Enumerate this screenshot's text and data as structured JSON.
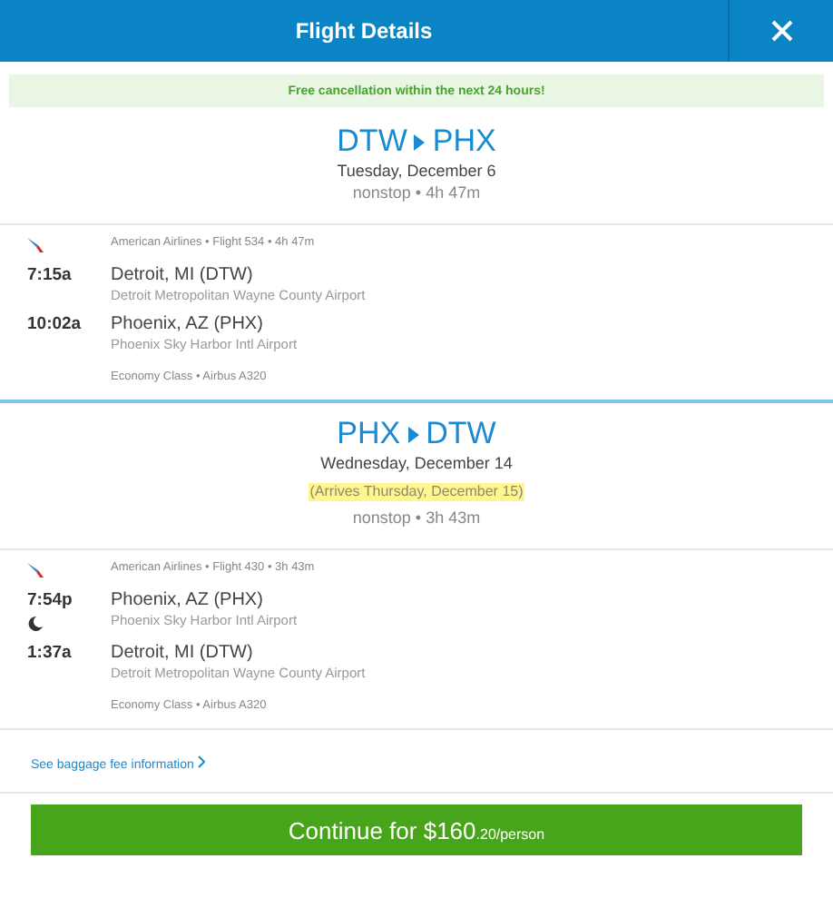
{
  "header": {
    "title": "Flight Details"
  },
  "notice": "Free cancellation within the next 24 hours!",
  "legs": [
    {
      "origin": "DTW",
      "destination": "PHX",
      "date": "Tuesday, December 6",
      "summary": "nonstop • 4h 47m",
      "segment": {
        "info": "American Airlines • Flight 534 • 4h 47m",
        "stops": [
          {
            "time": "7:15a",
            "city": "Detroit, MI (DTW)",
            "airport": "Detroit Metropolitan Wayne County Airport",
            "overnight": false
          },
          {
            "time": "10:02a",
            "city": "Phoenix, AZ (PHX)",
            "airport": "Phoenix Sky Harbor Intl Airport",
            "overnight": false
          }
        ],
        "cabin": "Economy Class • Airbus A320"
      }
    },
    {
      "origin": "PHX",
      "destination": "DTW",
      "date": "Wednesday, December 14",
      "arrival_note": "(Arrives Thursday, December 15)",
      "summary": "nonstop • 3h 43m",
      "segment": {
        "info": "American Airlines • Flight 430 • 3h 43m",
        "stops": [
          {
            "time": "7:54p",
            "city": "Phoenix, AZ (PHX)",
            "airport": "Phoenix Sky Harbor Intl Airport",
            "overnight": true
          },
          {
            "time": "1:37a",
            "city": "Detroit, MI (DTW)",
            "airport": "Detroit Metropolitan Wayne County Airport",
            "overnight": false
          }
        ],
        "cabin": "Economy Class • Airbus A320"
      }
    }
  ],
  "baggage_link": "See baggage fee information",
  "continue_button": {
    "label": "Continue for $160",
    "cents": ".20/person"
  }
}
